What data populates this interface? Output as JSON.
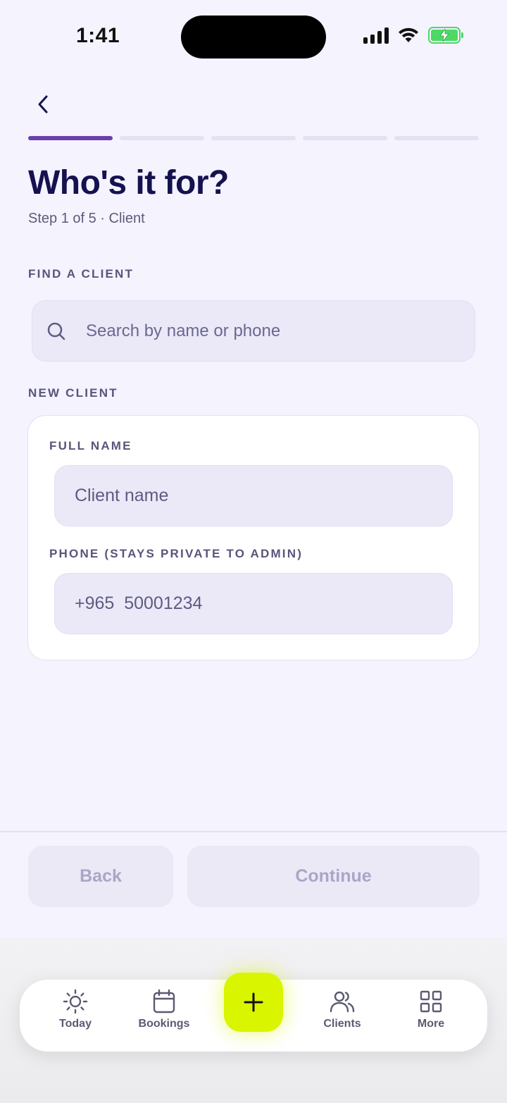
{
  "status_bar": {
    "time": "1:41"
  },
  "header": {
    "title": "Who's it for?",
    "subtitle": "Step 1 of 5 · Client",
    "progress": {
      "current_step": 1,
      "total_steps": 5
    }
  },
  "find_client": {
    "label": "FIND A CLIENT",
    "search_placeholder": "Search by name or phone"
  },
  "new_client": {
    "label": "NEW CLIENT",
    "full_name_label": "FULL NAME",
    "full_name_placeholder": "Client name",
    "phone_label": "PHONE (STAYS PRIVATE TO ADMIN)",
    "phone_value": "+965  50001234"
  },
  "actions": {
    "back_label": "Back",
    "continue_label": "Continue"
  },
  "tab_bar": {
    "items": [
      {
        "label": "Today",
        "icon": "sun-icon"
      },
      {
        "label": "Bookings",
        "icon": "calendar-icon"
      },
      {
        "label": "Clients",
        "icon": "users-icon"
      },
      {
        "label": "More",
        "icon": "grid-icon"
      }
    ],
    "fab_icon": "plus-icon"
  },
  "colors": {
    "accent": "#6b3fad",
    "fab": "#daf500",
    "title": "#14124f",
    "background": "#f4f3fe"
  }
}
